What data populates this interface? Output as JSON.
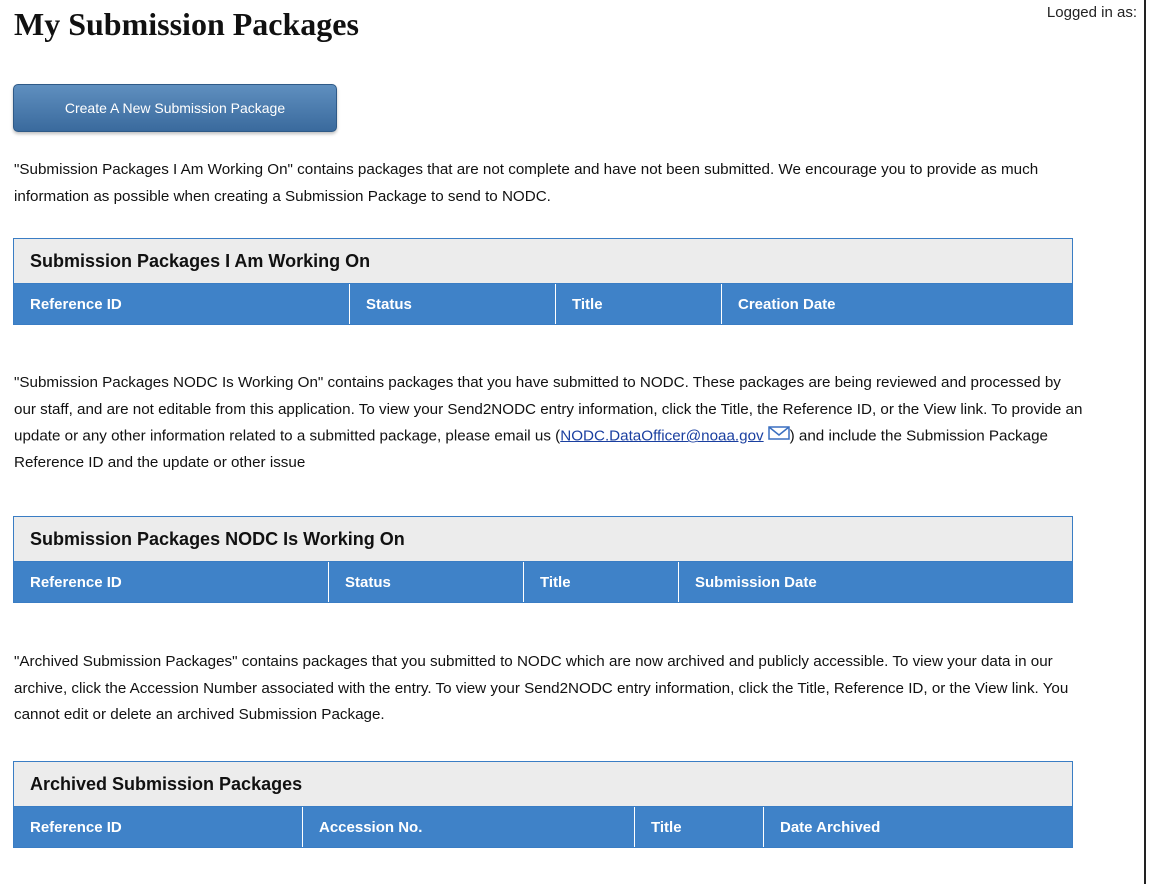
{
  "header": {
    "title": "My Submission Packages",
    "logged_in_label": "Logged in as:"
  },
  "actions": {
    "create_label": "Create A New Submission Package"
  },
  "sections": [
    {
      "description": "\"Submission Packages I Am Working On\" contains packages that are not complete and have not been submitted. We encourage you to provide as much information as possible when creating a Submission Package to send to NODC.",
      "table_title": "Submission Packages I Am Working On",
      "columns": [
        "Reference ID",
        "Status",
        "Title",
        "Creation Date"
      ]
    },
    {
      "description_before": "\"Submission Packages NODC Is Working On\" contains packages that you have submitted to NODC. These packages are being reviewed and processed by our staff, and are not editable from this application. To view your Send2NODC entry information, click the Title, the Reference ID, or the View link. To provide an update or any other information related to a submitted package, please email us (",
      "email": "NODC.DataOfficer@noaa.gov",
      "description_after": ") and include the Submission Package Reference ID and the update or other issue",
      "table_title": "Submission Packages NODC Is Working On",
      "columns": [
        "Reference ID",
        "Status",
        "Title",
        "Submission Date"
      ]
    },
    {
      "description": "\"Archived Submission Packages\" contains packages that you submitted to NODC which are now archived and publicly accessible. To view your data in our archive, click the Accession Number associated with the entry. To view your Send2NODC entry information, click the Title, Reference ID, or the View link. You cannot edit or delete an archived Submission Package.",
      "table_title": "Archived Submission Packages",
      "columns": [
        "Reference ID",
        "Accession No.",
        "Title",
        "Date Archived"
      ]
    }
  ],
  "icons": {
    "email": "mail-icon"
  },
  "colors": {
    "header_blue": "#3f82c8",
    "button_blue": "#4a7aad",
    "link": "#1a3fa0"
  }
}
